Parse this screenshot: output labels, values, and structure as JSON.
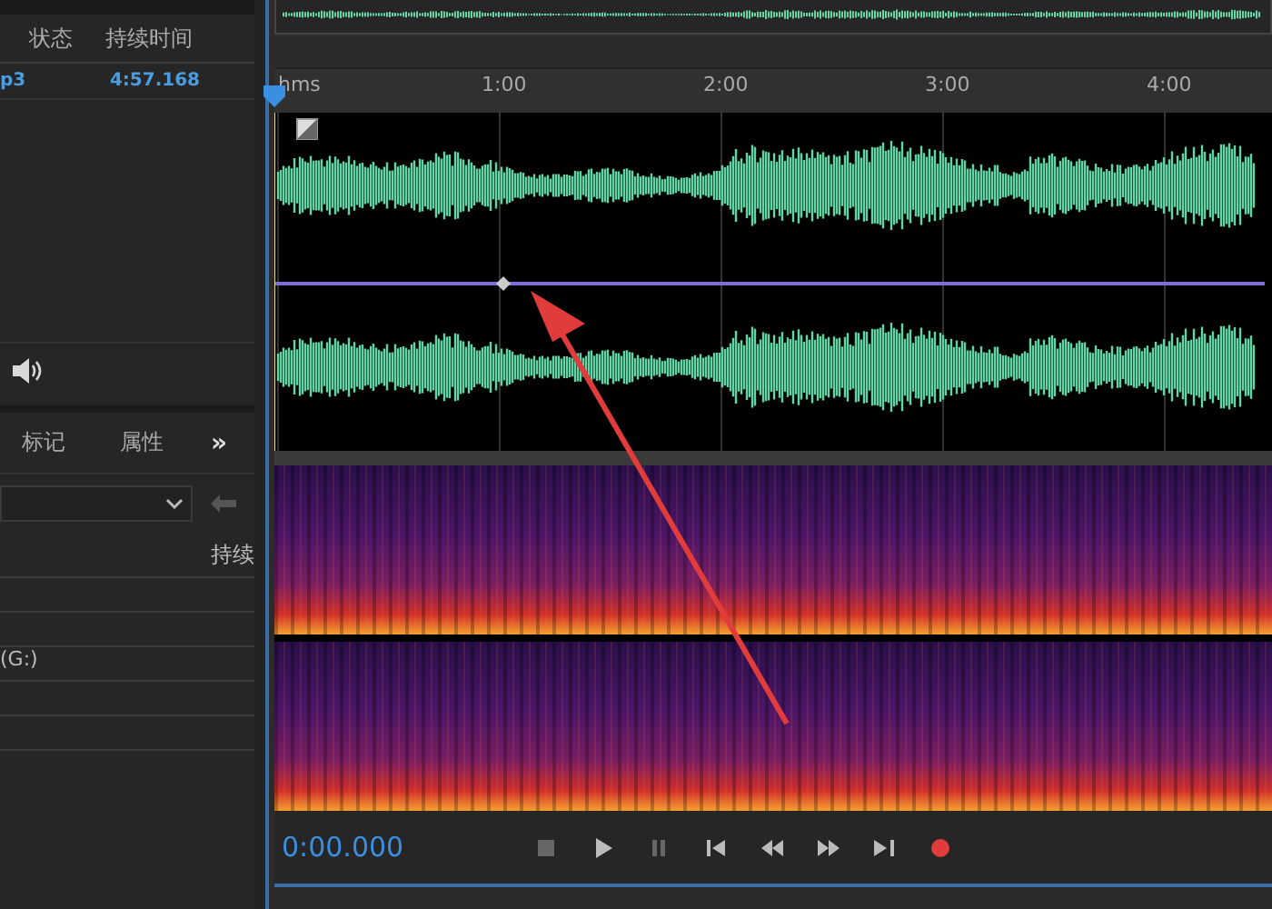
{
  "files_panel": {
    "columns": [
      "状态",
      "持续时间"
    ],
    "rows": [
      {
        "name": "p3",
        "duration": "4:57.168",
        "selected": true
      }
    ]
  },
  "panel_tabs": [
    {
      "label": "标记",
      "selected": false
    },
    {
      "label": "属性",
      "selected": false
    }
  ],
  "more_tabs": "»",
  "markers_list": {
    "column": "持续",
    "items": [
      {
        "label": "(G:)"
      }
    ]
  },
  "ruler": {
    "labels": [
      "hms",
      "1:00",
      "2:00",
      "3:00",
      "4:00"
    ]
  },
  "transport": {
    "time": "0:00.000",
    "buttons": [
      {
        "kind": "stop"
      },
      {
        "kind": "play"
      },
      {
        "kind": "pause"
      },
      {
        "kind": "start"
      },
      {
        "kind": "rewind"
      },
      {
        "kind": "forward"
      },
      {
        "kind": "end"
      },
      {
        "kind": "record"
      }
    ]
  }
}
